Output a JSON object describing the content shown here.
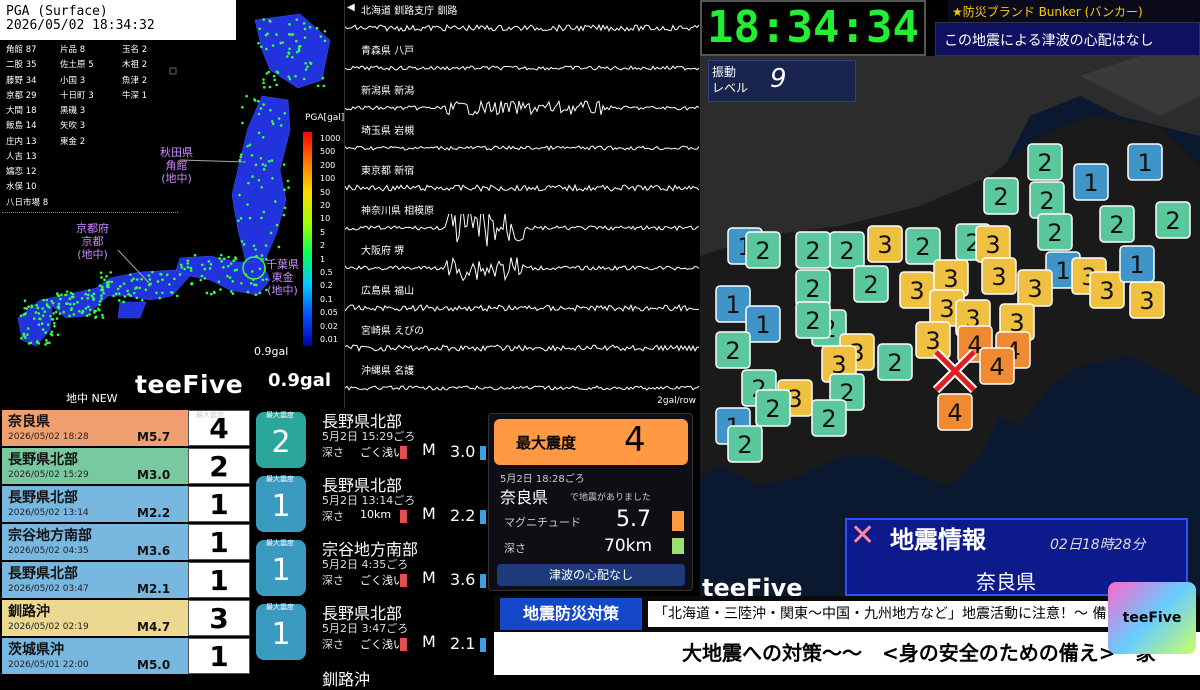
{
  "pga": {
    "header_line1": "PGA (Surface)",
    "header_line2": "2026/05/02 18:34:32",
    "stations": [
      "角館 87",
      "片品 8",
      "玉名 2",
      "二股 35",
      "佐土原 5",
      "木祖 2",
      "藤野 34",
      "小国 3",
      "魚津 2",
      "京都 29",
      "十日町 3",
      "牛深 1",
      "大間 18",
      "黒磯 3",
      "",
      "飯島 14",
      "矢吹 3",
      "",
      "庄内 13",
      "東金 2",
      "",
      "人吉 13",
      "",
      "",
      "嬬恋 12",
      "",
      "",
      "水俣 10",
      "",
      "",
      "八日市場 8",
      "",
      ""
    ],
    "scale_title": "PGA[gal]",
    "scale_ticks": [
      "1000",
      "500",
      "200",
      "100",
      "50",
      "20",
      "10",
      "5",
      "2",
      "1",
      "0.5",
      "0.2",
      "0.1",
      "0.05",
      "0.02",
      "0.01"
    ],
    "label_akita": [
      "秋田県",
      "角館",
      "(地中)"
    ],
    "label_kyoto": [
      "京都府",
      "京都",
      "(地中)"
    ],
    "label_chiba": [
      "千葉県",
      "東金",
      "(地中)"
    ],
    "min_value": "0.9gal",
    "big_value": "0.9gal",
    "brand": "teeFive",
    "brand_sub": "PROJECT",
    "new_label": "地中 NEW"
  },
  "waveform": {
    "rows": [
      "北海道 釧路支庁 釧路",
      "青森県 八戸",
      "新潟県 新潟",
      "埼玉県 岩槻",
      "東京都 新宿",
      "神奈川県 相模原",
      "大阪府 堺",
      "広島県 福山",
      "宮崎県 えびの",
      "沖縄県 名護"
    ],
    "scale": "2gal/row"
  },
  "clock": "18:34:34",
  "brand_top": "★防災ブランド Bunker (バンカー)",
  "tsunami_top": "この地震による津波の心配はなし",
  "shindo": {
    "label_line1": "振動",
    "label_line2": "レベル",
    "value": "9"
  },
  "map": {
    "tiles": [
      {
        "v": "2",
        "c": "#5ac89c"
      },
      {
        "v": "1",
        "c": "#3f94c8"
      },
      {
        "v": "1",
        "c": "#3f94c8"
      },
      {
        "v": "2",
        "c": "#5ac89c"
      },
      {
        "v": "2",
        "c": "#5ac89c"
      },
      {
        "v": "2",
        "c": "#5ac89c"
      },
      {
        "v": "2",
        "c": "#5ac89c"
      },
      {
        "v": "1",
        "c": "#3f94c8"
      },
      {
        "v": "2",
        "c": "#5ac89c"
      },
      {
        "v": "2",
        "c": "#5ac89c"
      },
      {
        "v": "2",
        "c": "#5ac89c"
      },
      {
        "v": "3",
        "c": "#f0c040"
      },
      {
        "v": "2",
        "c": "#5ac89c"
      },
      {
        "v": "2",
        "c": "#5ac89c"
      },
      {
        "v": "3",
        "c": "#f0c040"
      },
      {
        "v": "2",
        "c": "#5ac89c"
      },
      {
        "v": "1",
        "c": "#3f94c8"
      },
      {
        "v": "2",
        "c": "#5ac89c"
      },
      {
        "v": "2",
        "c": "#5ac89c"
      },
      {
        "v": "3",
        "c": "#f0c040"
      },
      {
        "v": "3",
        "c": "#f0c040"
      },
      {
        "v": "3",
        "c": "#f0c040"
      },
      {
        "v": "3",
        "c": "#f0c040"
      },
      {
        "v": "3",
        "c": "#f0c040"
      },
      {
        "v": "3",
        "c": "#f0c040"
      },
      {
        "v": "3",
        "c": "#f0c040"
      },
      {
        "v": "2",
        "c": "#5ac89c"
      },
      {
        "v": "1",
        "c": "#3f94c8"
      },
      {
        "v": "1",
        "c": "#3f94c8"
      },
      {
        "v": "2",
        "c": "#5ac89c"
      },
      {
        "v": "3",
        "c": "#f0c040"
      },
      {
        "v": "3",
        "c": "#f0c040"
      },
      {
        "v": "3",
        "c": "#f0c040"
      },
      {
        "v": "3",
        "c": "#f0c040"
      },
      {
        "v": "4",
        "c": "#f08a30"
      },
      {
        "v": "4",
        "c": "#f08a30"
      },
      {
        "v": "3",
        "c": "#f0c040"
      },
      {
        "v": "2",
        "c": "#5ac89c"
      },
      {
        "v": "3",
        "c": "#f0c040"
      },
      {
        "v": "2",
        "c": "#5ac89c"
      },
      {
        "v": "2",
        "c": "#5ac89c"
      },
      {
        "v": "3",
        "c": "#f0c040"
      },
      {
        "v": "2",
        "c": "#5ac89c"
      },
      {
        "v": "2",
        "c": "#5ac89c"
      },
      {
        "v": "2",
        "c": "#5ac89c"
      },
      {
        "v": "4",
        "c": "#f08a30"
      },
      {
        "v": "1",
        "c": "#3f94c8"
      },
      {
        "v": "2",
        "c": "#5ac89c"
      },
      {
        "v": "1",
        "c": "#3f94c8"
      },
      {
        "v": "4",
        "c": "#f08a30"
      }
    ]
  },
  "quake_info": {
    "title": "地震情報",
    "date": "02日18時28分",
    "place": "奈良県",
    "brand": "teeFive"
  },
  "quake_list": {
    "max_label": "最大震度",
    "items": [
      {
        "name": "奈良県",
        "date": "2026/05/02 18:28",
        "mag": "M5.7",
        "max": "4",
        "color": "#f0a070"
      },
      {
        "name": "長野県北部",
        "date": "2026/05/02 15:29",
        "mag": "M3.0",
        "max": "2",
        "color": "#79c9a0"
      },
      {
        "name": "長野県北部",
        "date": "2026/05/02 13:14",
        "mag": "M2.2",
        "max": "1",
        "color": "#78b8e0"
      },
      {
        "name": "宗谷地方南部",
        "date": "2026/05/02 04:35",
        "mag": "M3.6",
        "max": "1",
        "color": "#78b8e0"
      },
      {
        "name": "長野県北部",
        "date": "2026/05/02 03:47",
        "mag": "M2.1",
        "max": "1",
        "color": "#78b8e0"
      },
      {
        "name": "釧路沖",
        "date": "2026/05/02 02:19",
        "mag": "M4.7",
        "max": "3",
        "color": "#ecd890"
      },
      {
        "name": "茨城県沖",
        "date": "2026/05/01 22:00",
        "mag": "M5.0",
        "max": "1",
        "color": "#78b8e0"
      }
    ]
  },
  "mid_list": {
    "badge_label": "最大震度",
    "items": [
      {
        "shindo": "2",
        "name": "長野県北部",
        "time": "5月2日 15:29ごろ",
        "depth_label": "深さ",
        "depth": "ごく浅い",
        "m": "M",
        "mag": "3.0"
      },
      {
        "shindo": "1",
        "name": "長野県北部",
        "time": "5月2日 13:14ごろ",
        "depth_label": "深さ",
        "depth": "10km",
        "m": "M",
        "mag": "2.2"
      },
      {
        "shindo": "1",
        "name": "宗谷地方南部",
        "time": "5月2日 4:35ごろ",
        "depth_label": "深さ",
        "depth": "ごく浅い",
        "m": "M",
        "mag": "3.6"
      },
      {
        "shindo": "1",
        "name": "長野県北部",
        "time": "5月2日 3:47ごろ",
        "depth_label": "深さ",
        "depth": "ごく浅い",
        "m": "M",
        "mag": "2.1"
      }
    ],
    "partial": "釧路沖"
  },
  "center_info": {
    "max_label": "最大震度",
    "max_value": "4",
    "date": "5月2日 18:28ごろ",
    "place": "奈良県",
    "place_sub": "で地震がありました",
    "mag_label": "マグニチュード",
    "mag_value": "5.7",
    "depth_label": "深さ",
    "depth_value": "70km",
    "tsunami": "津波の心配なし"
  },
  "ticker": {
    "label": "地震防災対策",
    "text": "「北海道・三陸沖・関東～中国・九州地方など」地震活動に注意！～ 備えを",
    "bottom": "大地震への対策～～　<身の安全のための備え>　家"
  },
  "corner_logo": "teeFive"
}
